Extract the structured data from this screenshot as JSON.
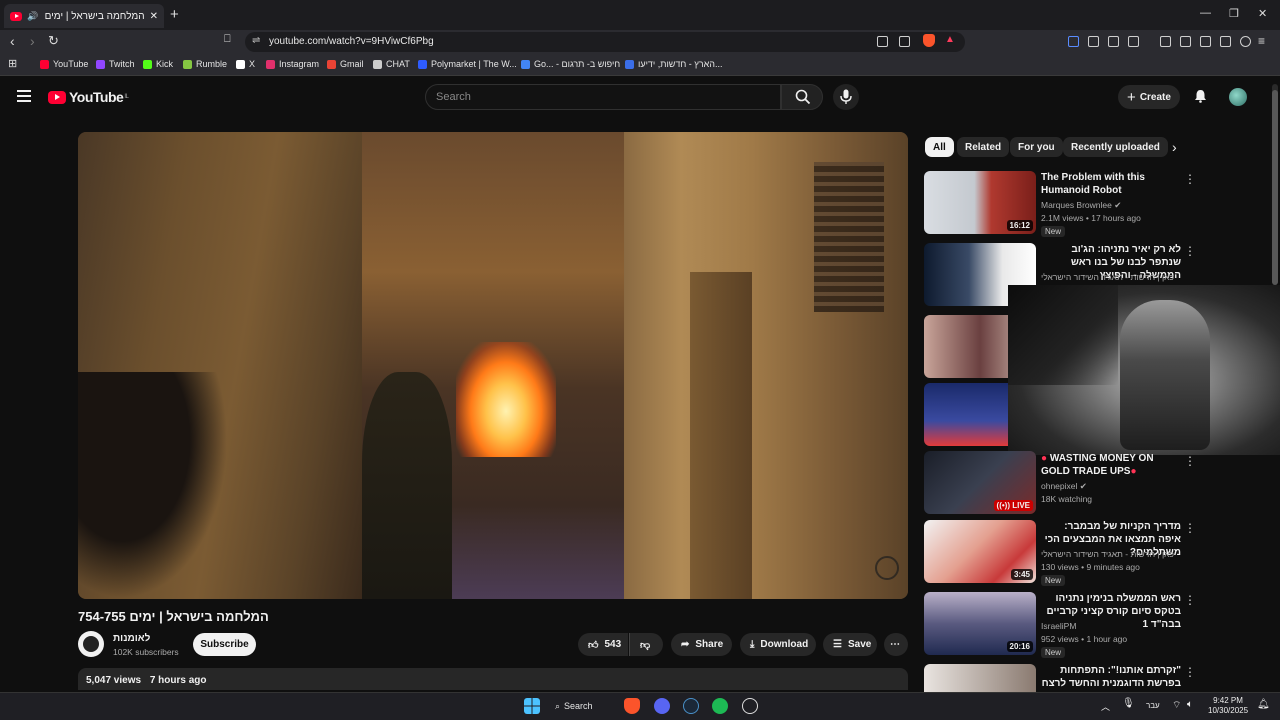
{
  "browser": {
    "tab_title": "המלחמה בישראל | ימים 754-755",
    "url": "youtube.com/watch?v=9HViwCf6Pbg",
    "bookmarks": [
      {
        "label": "YouTube",
        "color": "#ff0033"
      },
      {
        "label": "Twitch",
        "color": "#9146ff"
      },
      {
        "label": "Kick",
        "color": "#53fc18"
      },
      {
        "label": "Rumble",
        "color": "#85c742"
      },
      {
        "label": "X",
        "color": "#ffffff"
      },
      {
        "label": "Instagram",
        "color": "#e1306c"
      },
      {
        "label": "Gmail",
        "color": "#ea4335"
      },
      {
        "label": "CHAT",
        "color": "#cccccc"
      },
      {
        "label": "Polymarket | The W...",
        "color": "#2e5cff"
      },
      {
        "label": "Go... - חיפוש ב- תרגום",
        "color": "#4285f4"
      },
      {
        "label": "הארץ - חדשות, ידיעו...",
        "color": "#3b6ee8"
      }
    ]
  },
  "header": {
    "logo_text": "YouTube",
    "country_code": "IL",
    "search_placeholder": "Search",
    "create_label": "Create"
  },
  "video": {
    "title": "המלחמה בישראל | ימים 754-755",
    "channel_name": "לאומנות",
    "subscribers": "102K subscribers",
    "subscribe_label": "Subscribe",
    "likes": "543",
    "share_label": "Share",
    "download_label": "Download",
    "save_label": "Save",
    "views": "5,047 views",
    "posted": "7 hours ago"
  },
  "chips": [
    "All",
    "Related",
    "For you",
    "Recently uploaded"
  ],
  "sidebar": [
    {
      "title": "The Problem with this Humanoid Robot",
      "channel": "Marques Brownlee",
      "meta": "2.1M views • 17 hours ago",
      "badge": "New",
      "duration": "16:12"
    },
    {
      "title": "לא רק יאיר נתניהו: הג'וב שנתפר לבנו של בנו ראש הממשלה - והפיצץ",
      "channel": "כאן | חדשות - תאגיד השידור הישראלי",
      "meta": "",
      "badge": "",
      "duration": ""
    },
    {
      "title": "WASTING MONEY ON GOLD TRADE UPS",
      "channel": "ohnepixel",
      "meta": "18K watching",
      "badge": "",
      "duration": "LIVE"
    },
    {
      "title": "מדריך הקניות של מבמבר: איפה תמצאו את המבצעים הכי משתלמים?",
      "channel": "כאן | חדשות - תאגיד השידור הישראלי",
      "meta": "130 views • 9 minutes ago",
      "badge": "New",
      "duration": "3:45"
    },
    {
      "title": "ראש הממשלה בנימין נתניהו בטקס סיום קורס קציני קרביים בבה\"ד 1",
      "channel": "IsraeliPM",
      "meta": "952 views • 1 hour ago",
      "badge": "New",
      "duration": "20:16"
    },
    {
      "title": "\"זקרתם אותנו!\": התפתחות בפרשת הדוגמנית והחשד לרצח",
      "channel": "",
      "meta": "",
      "badge": "",
      "duration": ""
    }
  ],
  "taskbar": {
    "search_label": "Search",
    "language": "עבר",
    "time": "9:42 PM",
    "date": "10/30/2025"
  },
  "colors": {
    "accent": "#ff0033",
    "background": "#0f0f0f",
    "surface": "#272727"
  }
}
